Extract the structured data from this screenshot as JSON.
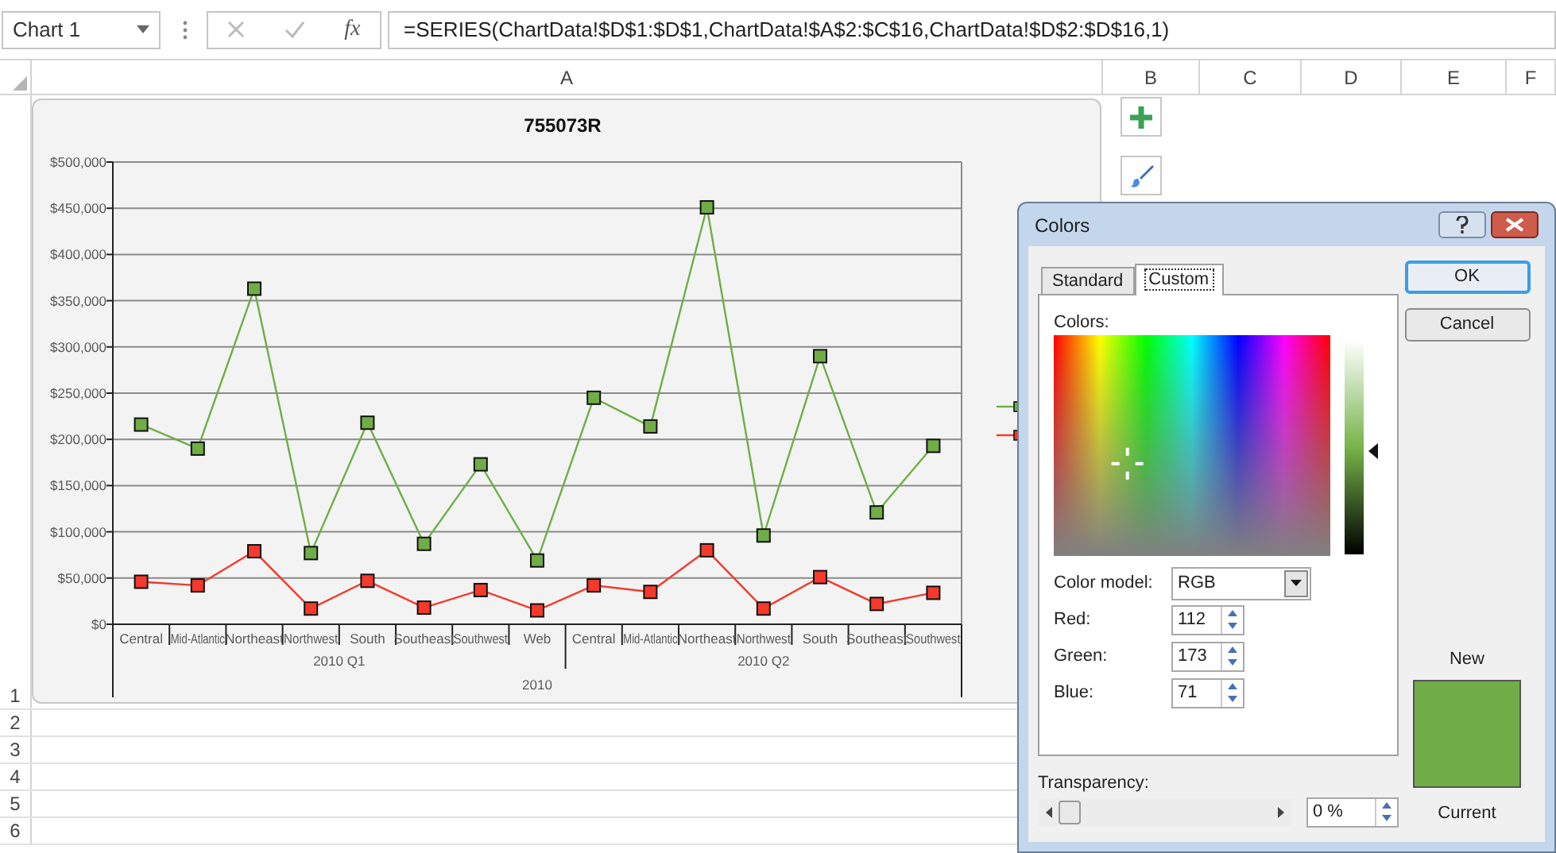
{
  "name_box": {
    "value": "Chart 1"
  },
  "formula_bar": {
    "function_label": "fx",
    "formula": "=SERIES(ChartData!$D$1:$D$1,ChartData!$A$2:$C$16,ChartData!$D$2:$D$16,1)"
  },
  "columns": [
    "A",
    "B",
    "C",
    "D",
    "E",
    "F"
  ],
  "rows": [
    "1",
    "2",
    "3",
    "4",
    "5",
    "6"
  ],
  "chart": {
    "axis_groups": [
      {
        "label": "2010 Q1"
      },
      {
        "label": "2010 Q2"
      }
    ],
    "axis_outer_label": "2010",
    "chart_data": {
      "type": "line",
      "title": "755073R",
      "grid": true,
      "categories": [
        "Central",
        "Mid-Atlantic",
        "Northeast",
        "Northwest",
        "South",
        "Southeast",
        "Southwest",
        "Web",
        "Central",
        "Mid-Atlantic",
        "Northeast",
        "Northwest",
        "South",
        "Southeast",
        "Southwest"
      ],
      "series": [
        {
          "color": "#70ad47",
          "marker": "square",
          "values": [
            216000,
            190000,
            363000,
            77000,
            218000,
            87000,
            173000,
            69000,
            245000,
            214000,
            451000,
            96000,
            290000,
            121000,
            193000
          ]
        },
        {
          "color": "#f5392b",
          "marker": "square",
          "values": [
            46000,
            42000,
            79000,
            17000,
            47000,
            18000,
            37000,
            15000,
            42000,
            35000,
            80000,
            17000,
            51000,
            22000,
            34000
          ]
        }
      ],
      "ylim": [
        0,
        500000
      ],
      "yticks": [
        {
          "value": 0,
          "label": "$0"
        },
        {
          "value": 50000,
          "label": "$50,000"
        },
        {
          "value": 100000,
          "label": "$100,000"
        },
        {
          "value": 150000,
          "label": "$150,000"
        },
        {
          "value": 200000,
          "label": "$200,000"
        },
        {
          "value": 250000,
          "label": "$250,000"
        },
        {
          "value": 300000,
          "label": "$300,000"
        },
        {
          "value": 350000,
          "label": "$350,000"
        },
        {
          "value": 400000,
          "label": "$400,000"
        },
        {
          "value": 450000,
          "label": "$450,000"
        },
        {
          "value": 500000,
          "label": "$500,000"
        }
      ]
    }
  },
  "dialog": {
    "title": "Colors",
    "tabs": [
      {
        "label": "Standard",
        "selected": false
      },
      {
        "label": "Custom",
        "selected": true
      }
    ],
    "colors_label": "Colors:",
    "color_model": {
      "label": "Color model:",
      "value": "RGB"
    },
    "channels": [
      {
        "label": "Red:",
        "value": "112"
      },
      {
        "label": "Green:",
        "value": "173"
      },
      {
        "label": "Blue:",
        "value": "71"
      }
    ],
    "transparency": {
      "label": "Transparency:",
      "level": 0,
      "value": "0 %"
    },
    "buttons": [
      {
        "label": "OK",
        "default": true
      },
      {
        "label": "Cancel",
        "default": false
      }
    ],
    "new_label": "New",
    "current_label": "Current"
  }
}
